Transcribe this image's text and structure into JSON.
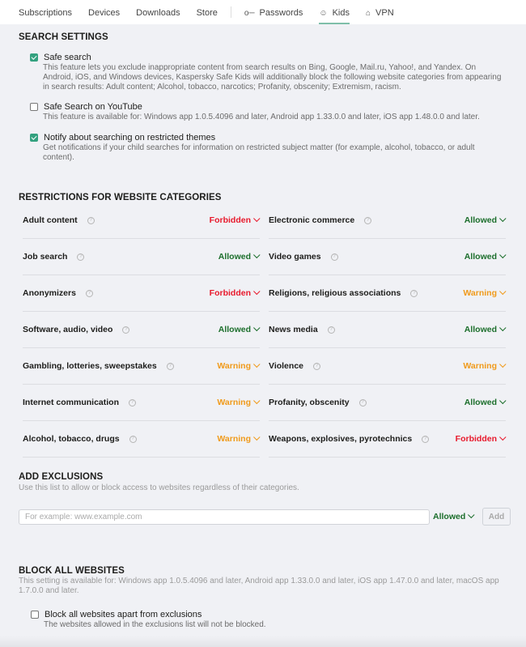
{
  "nav": {
    "tabs": [
      {
        "label": "Subscriptions",
        "icon": null,
        "active": false
      },
      {
        "label": "Devices",
        "icon": null,
        "active": false
      },
      {
        "label": "Downloads",
        "icon": null,
        "active": false
      },
      {
        "label": "Store",
        "icon": null,
        "active": false
      },
      {
        "label": "Passwords",
        "icon": "key-icon",
        "active": false
      },
      {
        "label": "Kids",
        "icon": "kid-face-icon",
        "active": true
      },
      {
        "label": "VPN",
        "icon": "lock-icon",
        "active": false
      }
    ]
  },
  "search_settings": {
    "title": "SEARCH SETTINGS",
    "options": [
      {
        "label": "Safe search",
        "checked": true,
        "description": "This feature lets you exclude inappropriate content from search results on Bing, Google, Mail.ru, Yahoo!, and Yandex. On Android, iOS, and Windows devices, Kaspersky Safe Kids will additionally block the following website categories from appearing in search results: Adult content; Alcohol, tobacco, narcotics; Profanity, obscenity; Extremism, racism."
      },
      {
        "label": "Safe Search on YouTube",
        "checked": false,
        "description": "This feature is available for: Windows app 1.0.5.4096 and later, Android app 1.33.0.0 and later, iOS app 1.48.0.0 and later."
      },
      {
        "label": "Notify about searching on restricted themes",
        "checked": true,
        "description": "Get notifications if your child searches for information on restricted subject matter (for example, alcohol, tobacco, or adult content)."
      }
    ]
  },
  "restrictions": {
    "title": "RESTRICTIONS FOR WEBSITE CATEGORIES",
    "categories": [
      {
        "name": "Adult content",
        "status": "Forbidden"
      },
      {
        "name": "Electronic commerce",
        "status": "Allowed"
      },
      {
        "name": "Job search",
        "status": "Allowed"
      },
      {
        "name": "Video games",
        "status": "Allowed"
      },
      {
        "name": "Anonymizers",
        "status": "Forbidden"
      },
      {
        "name": "Religions, religious associations",
        "status": "Warning"
      },
      {
        "name": "Software, audio, video",
        "status": "Allowed"
      },
      {
        "name": "News media",
        "status": "Allowed"
      },
      {
        "name": "Gambling, lotteries, sweepstakes",
        "status": "Warning"
      },
      {
        "name": "Violence",
        "status": "Warning"
      },
      {
        "name": "Internet communication",
        "status": "Warning"
      },
      {
        "name": "Profanity, obscenity",
        "status": "Allowed"
      },
      {
        "name": "Alcohol, tobacco, drugs",
        "status": "Warning"
      },
      {
        "name": "Weapons, explosives, pyrotechnics",
        "status": "Forbidden"
      }
    ]
  },
  "exclusions": {
    "title": "ADD EXCLUSIONS",
    "description": "Use this list to allow or block access to websites regardless of their categories.",
    "input_placeholder": "For example: www.example.com",
    "input_value": "",
    "status": "Allowed",
    "add_label": "Add"
  },
  "block_all": {
    "title": "BLOCK ALL WEBSITES",
    "description": "This setting is available for: Windows app 1.0.5.4096 and later, Android app 1.33.0.0 and later, iOS app 1.47.0.0 and later, macOS app 1.7.0.0 and later.",
    "option_label": "Block all websites apart from exclusions",
    "option_checked": false,
    "option_description": "The websites allowed in the exclusions list will not be blocked."
  },
  "colors": {
    "forbidden": "#e8192c",
    "allowed": "#1b6e2b",
    "warning": "#f09a1a",
    "accent": "#33a17f"
  }
}
